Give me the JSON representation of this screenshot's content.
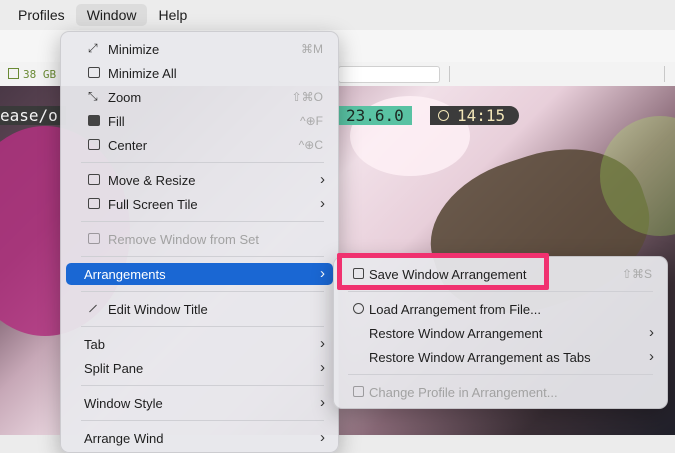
{
  "menubar": {
    "items": [
      "Profiles",
      "Window",
      "Help"
    ]
  },
  "statusbar": {
    "disk": "38 GB"
  },
  "terminal": {
    "prompt_left": "ease/o",
    "version": "23.6.0",
    "time": "14:15"
  },
  "window_menu": {
    "items": [
      {
        "label": "Minimize",
        "shortcut": "⌘M"
      },
      {
        "label": "Minimize All",
        "shortcut": ""
      },
      {
        "label": "Zoom",
        "shortcut": "⇧⌘O"
      },
      {
        "label": "Fill",
        "shortcut": "^⊕F"
      },
      {
        "label": "Center",
        "shortcut": "^⊕C"
      },
      {
        "label": "Move & Resize",
        "shortcut": ""
      },
      {
        "label": "Full Screen Tile",
        "shortcut": ""
      },
      {
        "label": "Remove Window from Set",
        "shortcut": ""
      },
      {
        "label": "Arrangements",
        "shortcut": ""
      },
      {
        "label": "Edit Window Title",
        "shortcut": ""
      },
      {
        "label": "Tab",
        "shortcut": ""
      },
      {
        "label": "Split Pane",
        "shortcut": ""
      },
      {
        "label": "Window Style",
        "shortcut": ""
      },
      {
        "label": "Arrange Wind",
        "shortcut": ""
      }
    ]
  },
  "arrangements_menu": {
    "items": [
      {
        "label": "Save Window Arrangement",
        "shortcut": "⇧⌘S"
      },
      {
        "label": "Load Arrangement from File...",
        "shortcut": ""
      },
      {
        "label": "Restore Window Arrangement",
        "shortcut": ""
      },
      {
        "label": "Restore Window Arrangement as Tabs",
        "shortcut": ""
      },
      {
        "label": "Change Profile in Arrangement...",
        "shortcut": ""
      }
    ]
  },
  "colors": {
    "highlight": "#1a67d3",
    "annotation": "#f0316f"
  }
}
